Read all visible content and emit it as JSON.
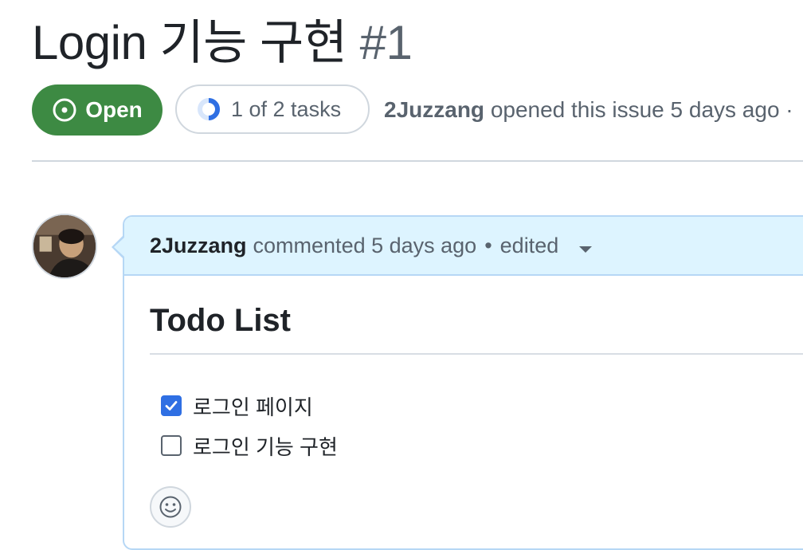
{
  "issue": {
    "title": "Login 기능 구현",
    "number": "#1",
    "state": "Open",
    "tasks_progress": "1 of 2 tasks",
    "tasks_completed": 1,
    "tasks_total": 2,
    "author": "2Juzzang",
    "opened_text": "opened this issue 5 days ago ·"
  },
  "comment": {
    "author": "2Juzzang",
    "action": "commented 5 days ago",
    "separator": "•",
    "edited": "edited",
    "heading": "Todo List",
    "tasks": [
      {
        "label": "로그인 페이지",
        "checked": true
      },
      {
        "label": "로그인 기능 구현",
        "checked": false
      }
    ]
  },
  "icons": {
    "state": "issue-opened-icon",
    "progress": "task-progress-icon",
    "avatar": "user-avatar",
    "reaction": "smiley-icon",
    "edited_menu": "triangle-down-icon"
  },
  "colors": {
    "open_green": "#3d8a43",
    "header_blue": "#ddf4ff",
    "header_border": "#b6d7f5",
    "checkbox_blue": "#2f6fe3"
  }
}
